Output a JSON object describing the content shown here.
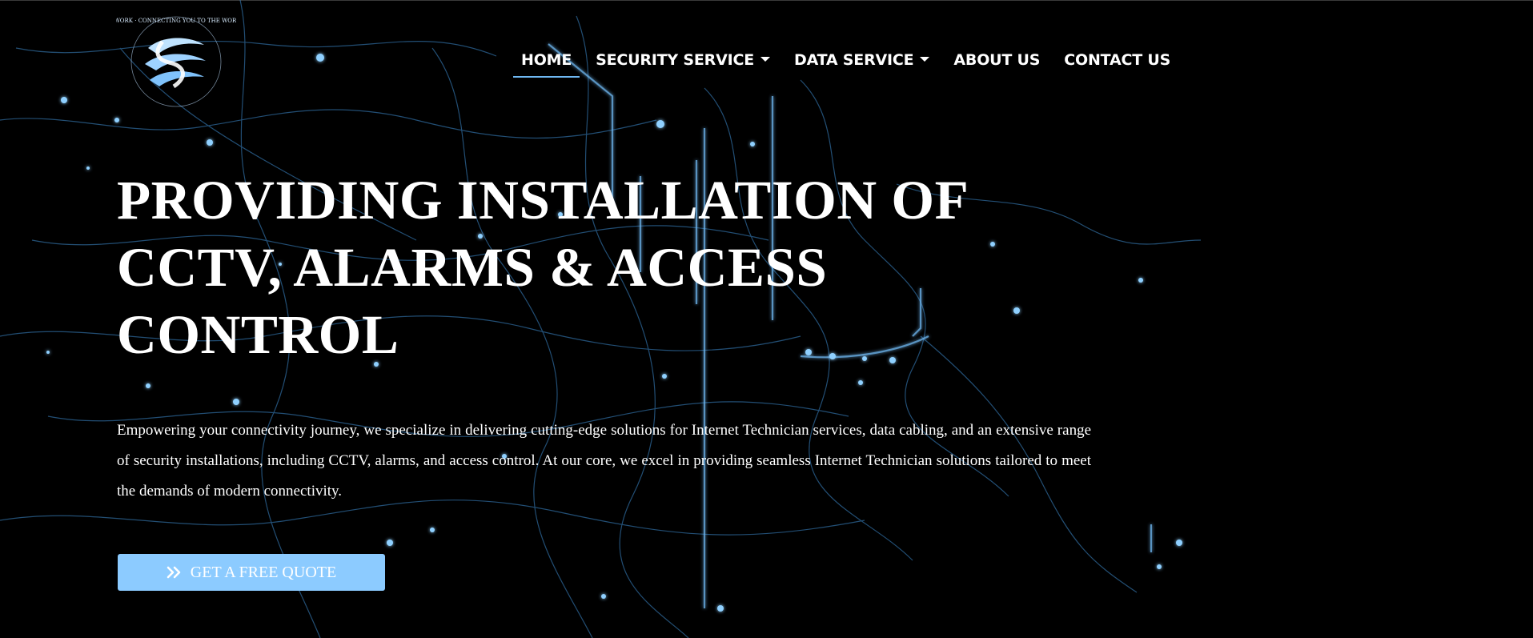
{
  "brand": {
    "logo_ring_text": "KINETIC NETWORK · CONNECTING YOU TO THE WORLD · WE CARE"
  },
  "nav": {
    "items": [
      {
        "label": "HOME",
        "active": true,
        "dropdown": false
      },
      {
        "label": "SECURITY SERVICE",
        "active": false,
        "dropdown": true
      },
      {
        "label": "DATA SERVICE",
        "active": false,
        "dropdown": true
      },
      {
        "label": "ABOUT US",
        "active": false,
        "dropdown": false
      },
      {
        "label": "CONTACT US",
        "active": false,
        "dropdown": false
      }
    ]
  },
  "hero": {
    "title_lines": [
      "PROVIDING INSTALLATION OF",
      "CCTV, ALARMS & ACCESS",
      "CONTROL"
    ],
    "description": "Empowering your connectivity journey, we specialize in delivering cutting-edge solutions for Internet Technician services, data cabling, and an extensive range of security installations, including CCTV, alarms, and access control. At our core, we excel in providing seamless Internet Technician solutions tailored to meet the demands of modern connectivity.",
    "cta_label": "GET A FREE QUOTE",
    "cta_icon": "double-chevron-right-icon"
  },
  "colors": {
    "background": "#000000",
    "accent": "#6fb8f2",
    "cta_background": "#8ccbff",
    "text": "#ffffff"
  }
}
